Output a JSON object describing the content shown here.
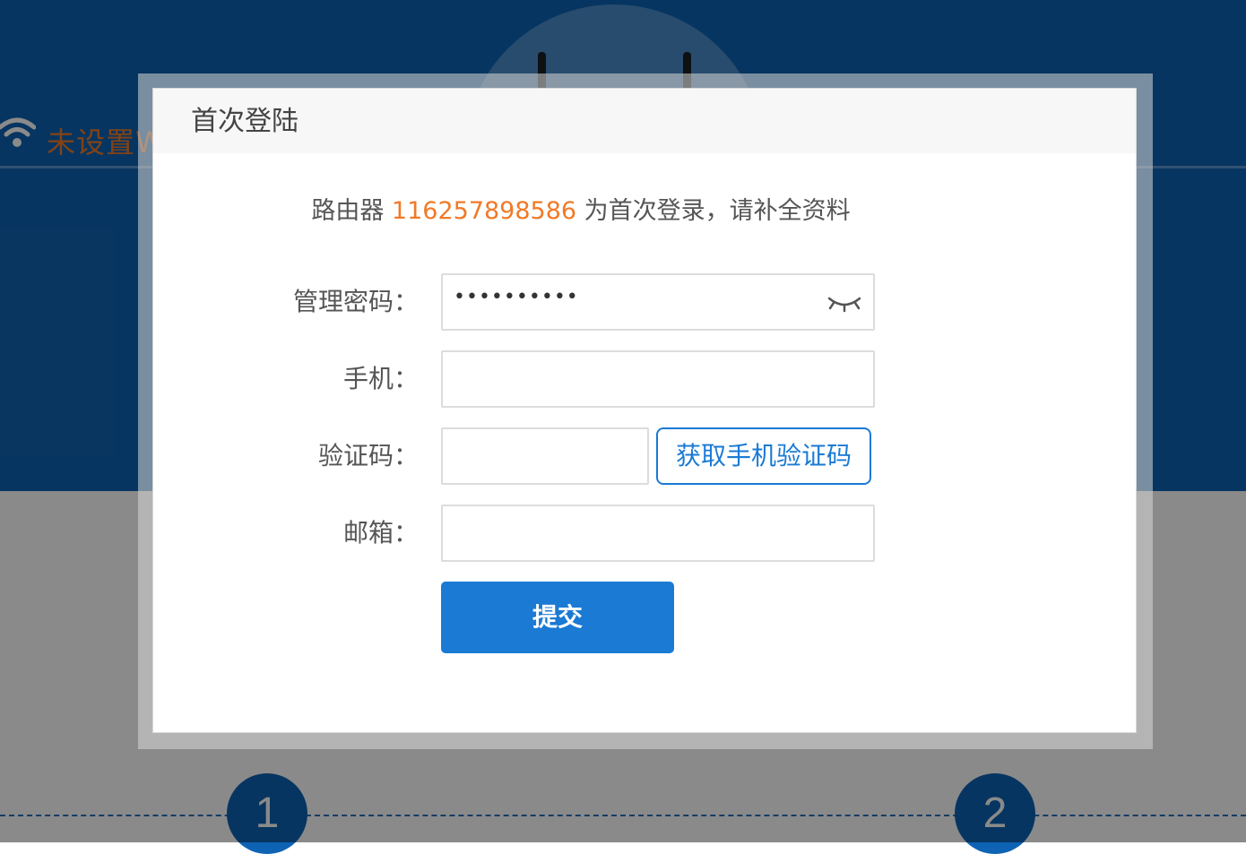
{
  "background": {
    "status_text": "未设置Wi-Fi",
    "steps": [
      "1",
      "2"
    ]
  },
  "modal": {
    "title": "首次登陆",
    "notice": {
      "prefix": "路由器 ",
      "router_id": "116257898586",
      "suffix": " 为首次登录，请补全资料"
    },
    "fields": {
      "password": {
        "label": "管理密码：",
        "value": "••••••••••"
      },
      "phone": {
        "label": "手机：",
        "value": ""
      },
      "code": {
        "label": "验证码：",
        "value": ""
      },
      "email": {
        "label": "邮箱：",
        "value": ""
      }
    },
    "sms_button_label": "获取手机验证码",
    "submit_label": "提交"
  },
  "colors": {
    "primary_blue": "#1a7ad4",
    "header_blue": "#0e63b4",
    "accent_orange": "#f07a28"
  },
  "icons": {
    "wifi": "wifi-icon",
    "password_visibility": "eye-closed-icon"
  }
}
